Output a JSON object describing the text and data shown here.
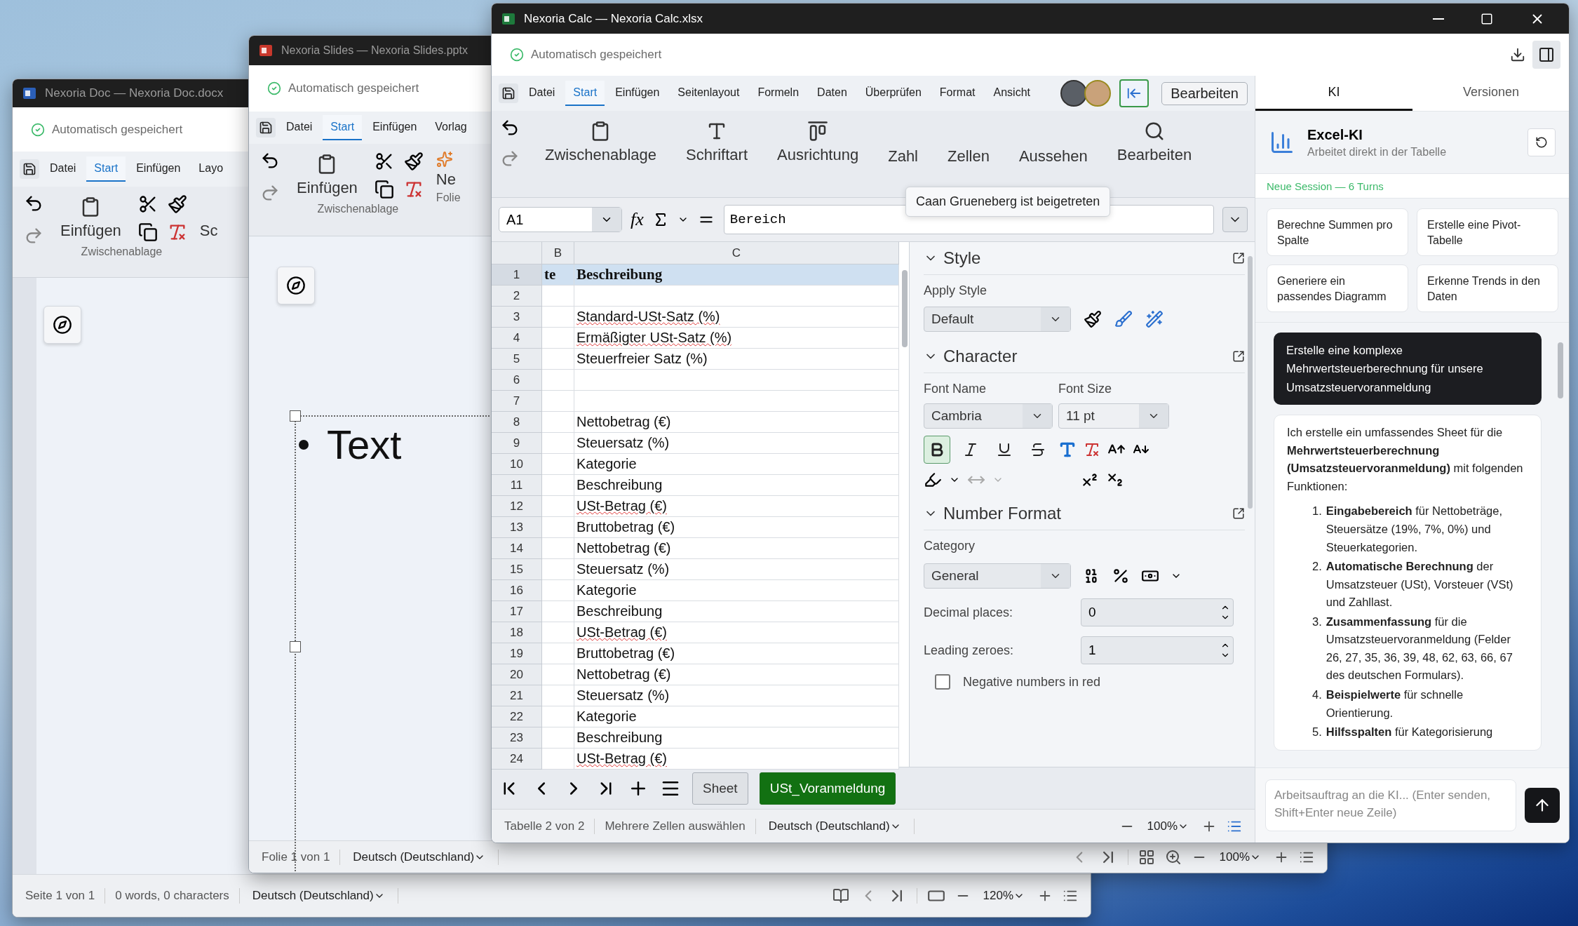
{
  "doc_window": {
    "title": "Nexoria Doc — Nexoria Doc.docx",
    "autosave": "Automatisch gespeichert",
    "tabs": [
      {
        "label": "Datei",
        "selected": false
      },
      {
        "label": "Start",
        "selected": true
      },
      {
        "label": "Einfügen",
        "selected": false
      },
      {
        "label": "Layo",
        "selected": false
      }
    ],
    "ribbon": {
      "paste_label": "Einfügen",
      "cut_off_label": "Sc",
      "group_label": "Zwischenablage"
    },
    "status_bar": {
      "page": "Seite 1 von 1",
      "counts": "0 words, 0 characters",
      "language": "Deutsch (Deutschland)",
      "zoom": "120%"
    }
  },
  "slides_window": {
    "title": "Nexoria Slides — Nexoria Slides.pptx",
    "autosave": "Automatisch gespeichert",
    "tabs": [
      {
        "label": "Datei",
        "selected": false
      },
      {
        "label": "Start",
        "selected": true
      },
      {
        "label": "Einfügen",
        "selected": false
      },
      {
        "label": "Vorlag",
        "selected": false
      }
    ],
    "ribbon": {
      "paste_label": "Einfügen",
      "cut_off_label": "Ne",
      "group_label": "Zwischenablage",
      "cut_off_group_label": "Folie"
    },
    "slide": {
      "bullet_text": "Text"
    },
    "status_bar": {
      "slide": "Folie 1 von 1",
      "language": "Deutsch (Deutschland)",
      "zoom": "100%"
    }
  },
  "calc_window": {
    "title": "Nexoria Calc — Nexoria Calc.xlsx",
    "autosave": "Automatisch gespeichert",
    "tabs": [
      {
        "label": "Datei",
        "selected": false
      },
      {
        "label": "Start",
        "selected": true
      },
      {
        "label": "Einfügen",
        "selected": false
      },
      {
        "label": "Seitenlayout",
        "selected": false
      },
      {
        "label": "Formeln",
        "selected": false
      },
      {
        "label": "Daten",
        "selected": false
      },
      {
        "label": "Überprüfen",
        "selected": false
      },
      {
        "label": "Format",
        "selected": false
      },
      {
        "label": "Ansicht",
        "selected": false
      }
    ],
    "edit_button": "Bearbeiten",
    "tooltip": "Caan Grueneberg ist beigetreten",
    "ribbon_groups": [
      {
        "kind": "clipboard",
        "label": "Zwischenablage"
      },
      {
        "kind": "font",
        "label": "Schriftart"
      },
      {
        "kind": "align",
        "label": "Ausrichtung"
      },
      {
        "kind": "hidden",
        "label": "Zahl"
      },
      {
        "kind": "hidden",
        "label": "Zellen"
      },
      {
        "kind": "hidden",
        "label": "Aussehen"
      },
      {
        "kind": "search",
        "label": "Bearbeiten"
      }
    ],
    "formula_bar": {
      "cell": "A1",
      "function_label": "fx",
      "content": "Bereich"
    },
    "grid": {
      "columns": [
        "B",
        "C"
      ],
      "rows": [
        {
          "number": "1",
          "b": "te",
          "c": "Beschreibung",
          "header": true,
          "selected": true
        },
        {
          "number": "2",
          "selected": false
        },
        {
          "number": "3",
          "c": "Standard-USt-Satz (%)",
          "spelling_error": true,
          "selected": false
        },
        {
          "number": "4",
          "c": "Ermäßigter USt-Satz (%)",
          "spelling_error": true,
          "selected": false
        },
        {
          "number": "5",
          "c": "Steuerfreier Satz (%)",
          "selected": false
        },
        {
          "number": "6",
          "selected": false
        },
        {
          "number": "7",
          "selected": false
        },
        {
          "number": "8",
          "c": "Nettobetrag (€)",
          "selected": false
        },
        {
          "number": "9",
          "c": "Steuersatz (%)",
          "selected": false
        },
        {
          "number": "10",
          "c": "Kategorie",
          "selected": false
        },
        {
          "number": "11",
          "c": "Beschreibung",
          "selected": false
        },
        {
          "number": "12",
          "c": "USt-Betrag (€)",
          "spelling_error": true,
          "selected": false
        },
        {
          "number": "13",
          "c": "Bruttobetrag (€)",
          "selected": false
        },
        {
          "number": "14",
          "c": "Nettobetrag (€)",
          "selected": false
        },
        {
          "number": "15",
          "c": "Steuersatz (%)",
          "selected": false
        },
        {
          "number": "16",
          "c": "Kategorie",
          "selected": false
        },
        {
          "number": "17",
          "c": "Beschreibung",
          "selected": false
        },
        {
          "number": "18",
          "c": "USt-Betrag (€)",
          "spelling_error": true,
          "selected": false
        },
        {
          "number": "19",
          "c": "Bruttobetrag (€)",
          "selected": false
        },
        {
          "number": "20",
          "c": "Nettobetrag (€)",
          "selected": false
        },
        {
          "number": "21",
          "c": "Steuersatz (%)",
          "selected": false
        },
        {
          "number": "22",
          "c": "Kategorie",
          "selected": false
        },
        {
          "number": "23",
          "c": "Beschreibung",
          "selected": false
        },
        {
          "number": "24",
          "c": "USt-Betrag (€)",
          "spelling_error": true,
          "selected": false
        }
      ]
    },
    "sidebar": {
      "style": {
        "title": "Style",
        "apply_label": "Apply Style",
        "value": "Default"
      },
      "character": {
        "title": "Character",
        "font_name_label": "Font Name",
        "font_size_label": "Font Size",
        "font_name": "Cambria",
        "font_size": "11 pt",
        "format_buttons": [
          {
            "kind": "bold",
            "selected": true
          },
          {
            "kind": "italic",
            "selected": false
          },
          {
            "kind": "underline",
            "selected": false
          },
          {
            "kind": "strikethrough",
            "selected": false
          }
        ],
        "spacing_disabled": true
      },
      "number_format": {
        "title": "Number Format",
        "category_label": "Category",
        "category": "General",
        "decimal_label": "Decimal places:",
        "decimal_value": "0",
        "leading_label": "Leading zeroes:",
        "leading_value": "1",
        "negative_red": {
          "label": "Negative numbers in red",
          "checked": false
        }
      }
    },
    "sheet_tabs": [
      {
        "label": "Sheet",
        "selected": false
      },
      {
        "label": "USt_Voranmeldung",
        "selected": true
      }
    ],
    "status_bar": {
      "sheet": "Tabelle 2 von 2",
      "selection_mode": "Mehrere Zellen auswählen",
      "language": "Deutsch (Deutschland)",
      "zoom": "100%"
    },
    "ai_panel": {
      "tabs": [
        {
          "label": "KI",
          "selected": true
        },
        {
          "label": "Versionen",
          "selected": false
        }
      ],
      "title": "Excel-KI",
      "subtitle": "Arbeitet direkt in der Tabelle",
      "session": "Neue Session — 6 Turns",
      "suggestions": [
        "Berechne Summen pro Spalte",
        "Erstelle eine Pivot-Tabelle",
        "Generiere ein passendes Diagramm",
        "Erkenne Trends in den Daten"
      ],
      "messages": [
        {
          "kind": "user",
          "text": "Erstelle eine komplexe Mehrwertsteuerberechnung für unsere Umsatzsteuervoranmeldung"
        },
        {
          "kind": "assistant",
          "text": "Ich erstelle ein umfassendes Sheet für die **Mehrwertsteuerberechnung (Umsatzsteuervoranmeldung)** mit folgenden Funktionen:",
          "items": [
            {
              "number": "1.",
              "text": "**Eingabebereich** für Nettobeträge, Steuersätze (19%, 7%, 0%) und Steuerkategorien."
            },
            {
              "number": "2.",
              "text": "**Automatische Berechnung** der Umsatzsteuer (USt), Vorsteuer (VSt) und Zahllast."
            },
            {
              "number": "3.",
              "text": "**Zusammenfassung** für die Umsatzsteuervoranmeldung (Felder 26, 27, 35, 36, 39, 48, 62, 63, 66, 67 des deutschen Formulars)."
            },
            {
              "number": "4.",
              "text": "**Beispielwerte** für schnelle Orientierung."
            },
            {
              "number": "5.",
              "text": "**Hilfsspalten** für Kategorisierung"
            }
          ]
        }
      ],
      "input_placeholder": "Arbeitsauftrag an die KI... (Enter senden, Shift+Enter neue Zeile)"
    }
  }
}
